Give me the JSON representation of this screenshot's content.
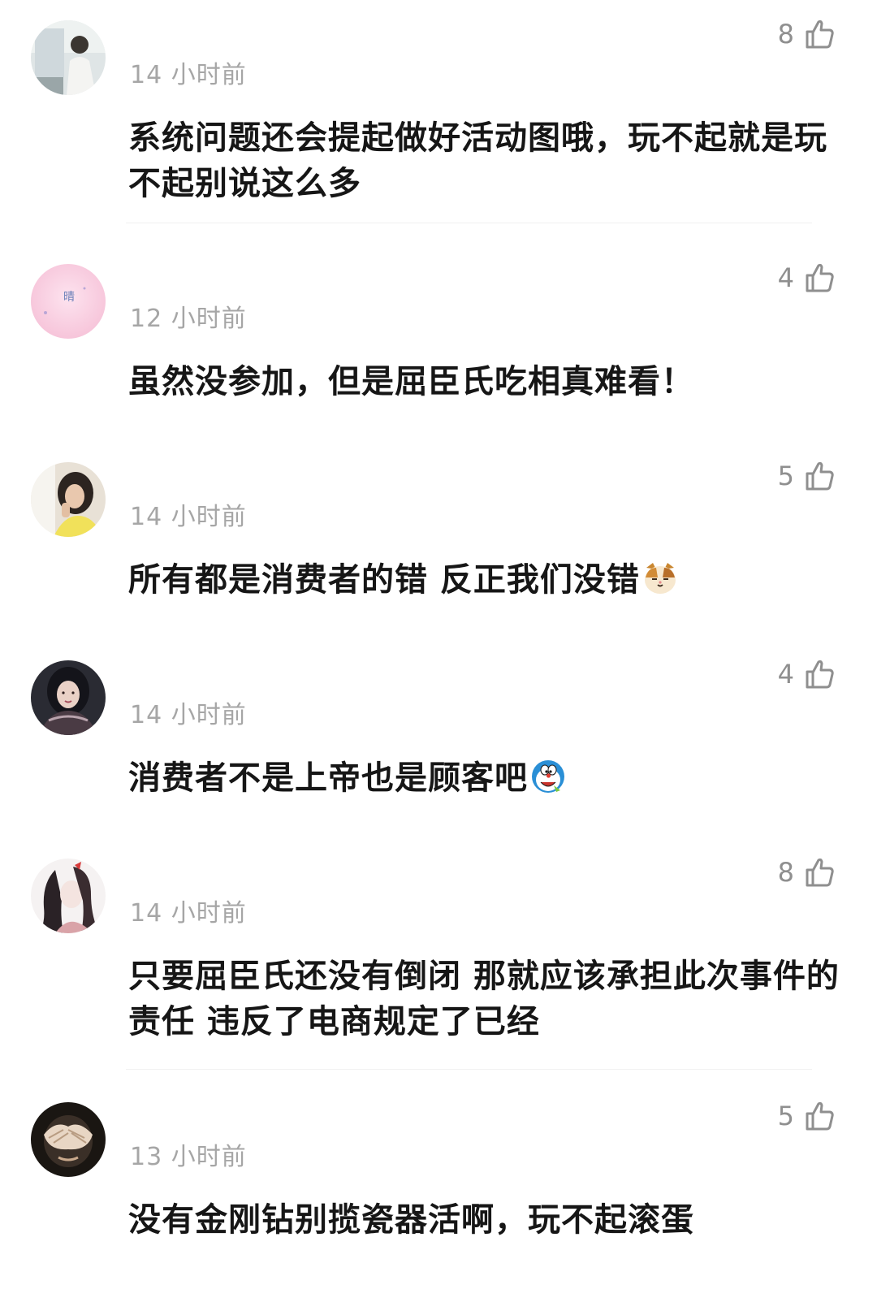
{
  "comments": [
    {
      "avatar": "avatar-photo-man-at-desk",
      "time": "14 小时前",
      "likes": "8",
      "text": "系统问题还会提起做好活动图哦，玩不起就是玩不起别说这么多",
      "emoji": null
    },
    {
      "avatar": "avatar-pink-with-text",
      "avatar_text": "晴",
      "time": "12 小时前",
      "likes": "4",
      "text": "虽然没参加，但是屈臣氏吃相真难看！",
      "emoji": null
    },
    {
      "avatar": "avatar-photo-girl-yellow",
      "time": "14 小时前",
      "likes": "5",
      "text": "所有都是消费者的错 反正我们没错",
      "emoji": "cat-emoji"
    },
    {
      "avatar": "avatar-photo-girl-dark",
      "time": "14 小时前",
      "likes": "4",
      "text": "消费者不是上帝也是顾客吧",
      "emoji": "doraemon-emoji"
    },
    {
      "avatar": "avatar-illustrated-girl",
      "time": "14 小时前",
      "likes": "8",
      "text": "只要屈臣氏还没有倒闭 那就应该承担此次事件的责任  违反了电商规定了已经",
      "emoji": null
    },
    {
      "avatar": "avatar-photo-hands-over-face",
      "time": "13 小时前",
      "likes": "5",
      "text": "没有金刚钻别揽瓷器活啊，玩不起滚蛋",
      "emoji": null
    }
  ],
  "colors": {
    "time": "#a6a6a6",
    "likes": "#8f8f8f",
    "text": "#161616",
    "divider": "#f1f1f1"
  }
}
